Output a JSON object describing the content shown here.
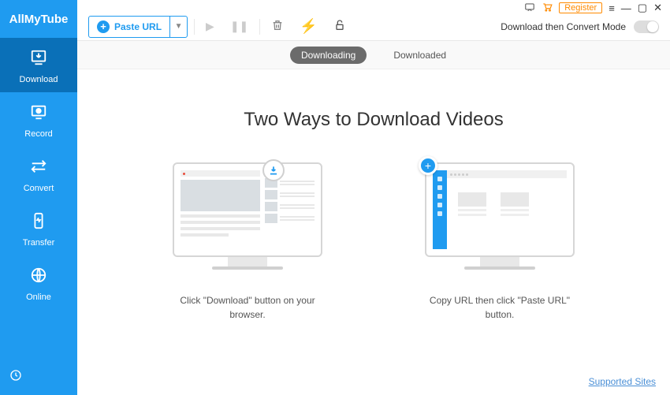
{
  "brand": "AllMyTube",
  "sidebar": {
    "items": [
      {
        "label": "Download"
      },
      {
        "label": "Record"
      },
      {
        "label": "Convert"
      },
      {
        "label": "Transfer"
      },
      {
        "label": "Online"
      }
    ]
  },
  "titlebar": {
    "register": "Register"
  },
  "toolbar": {
    "paste_label": "Paste URL",
    "mode_label": "Download then Convert Mode"
  },
  "tabs": {
    "downloading": "Downloading",
    "downloaded": "Downloaded"
  },
  "content": {
    "headline": "Two Ways to Download Videos",
    "method1_caption": "Click \"Download\" button on your browser.",
    "method2_caption": "Copy URL then click \"Paste URL\" button."
  },
  "footer": {
    "supported_sites": "Supported Sites"
  }
}
